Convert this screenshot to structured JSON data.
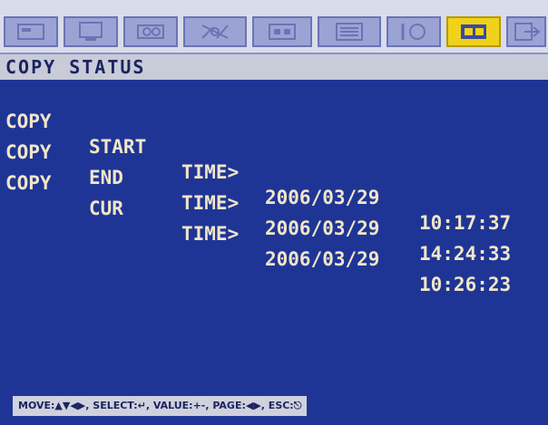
{
  "tabs": [
    {
      "icon": "system-icon"
    },
    {
      "icon": "display-icon"
    },
    {
      "icon": "camera-icon"
    },
    {
      "icon": "motion-icon"
    },
    {
      "icon": "record-icon"
    },
    {
      "icon": "schedule-icon"
    },
    {
      "icon": "network-icon"
    },
    {
      "icon": "copy-icon",
      "active": true
    },
    {
      "icon": "exit-icon"
    }
  ],
  "section_title": "COPY STATUS",
  "rows": [
    {
      "c1": "COPY",
      "c2": "START",
      "c3": "TIME>",
      "date": "2006/03/29",
      "time": "10:17:37"
    },
    {
      "c1": "COPY",
      "c2": "END",
      "c3": "TIME>",
      "date": "2006/03/29",
      "time": "14:24:33"
    },
    {
      "c1": "COPY",
      "c2": "CUR",
      "c3": "TIME>",
      "date": "2006/03/29",
      "time": "10:26:23"
    }
  ],
  "footer": "MOVE:▲▼◀▶, SELECT:↵, VALUE:+-, PAGE:◀▶, ESC:⎋",
  "colors": {
    "background": "#1f3596",
    "text": "#f0e6c8",
    "active_tab": "#f0d21a"
  }
}
